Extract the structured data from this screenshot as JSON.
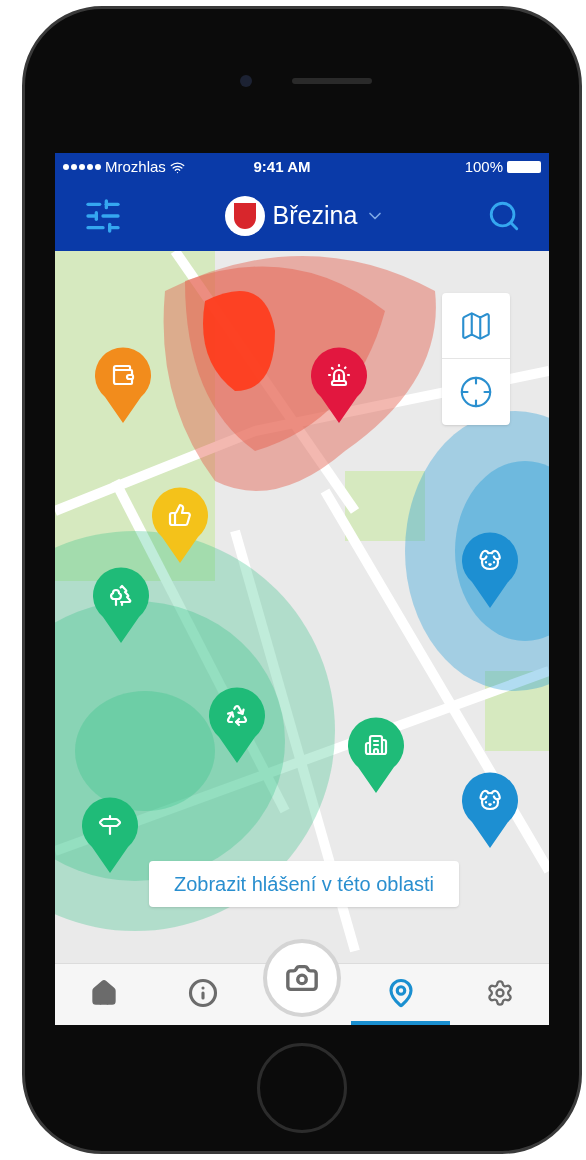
{
  "status_bar": {
    "carrier": "Mrozhlas",
    "time": "9:41 AM",
    "battery": "100%"
  },
  "header": {
    "title": "Březina"
  },
  "map": {
    "pins": [
      {
        "kind": "wallet",
        "color": "#f28c1c"
      },
      {
        "kind": "alarm",
        "color": "#e2173f"
      },
      {
        "kind": "thumbs-up",
        "color": "#f4c21a"
      },
      {
        "kind": "trees",
        "color": "#1fbb78"
      },
      {
        "kind": "dog",
        "color": "#1d8fd2"
      },
      {
        "kind": "recycle",
        "color": "#1fbb78"
      },
      {
        "kind": "building",
        "color": "#1fbb78"
      },
      {
        "kind": "signpost",
        "color": "#1fbb78"
      },
      {
        "kind": "dog",
        "color": "#1d8fd2"
      }
    ],
    "area_button": "Zobrazit hlášení v této oblasti"
  },
  "tabs": [
    {
      "kind": "home",
      "selected": false
    },
    {
      "kind": "info",
      "selected": false
    },
    {
      "kind": "camera",
      "selected": false
    },
    {
      "kind": "map",
      "selected": true
    },
    {
      "kind": "settings",
      "selected": false
    }
  ]
}
